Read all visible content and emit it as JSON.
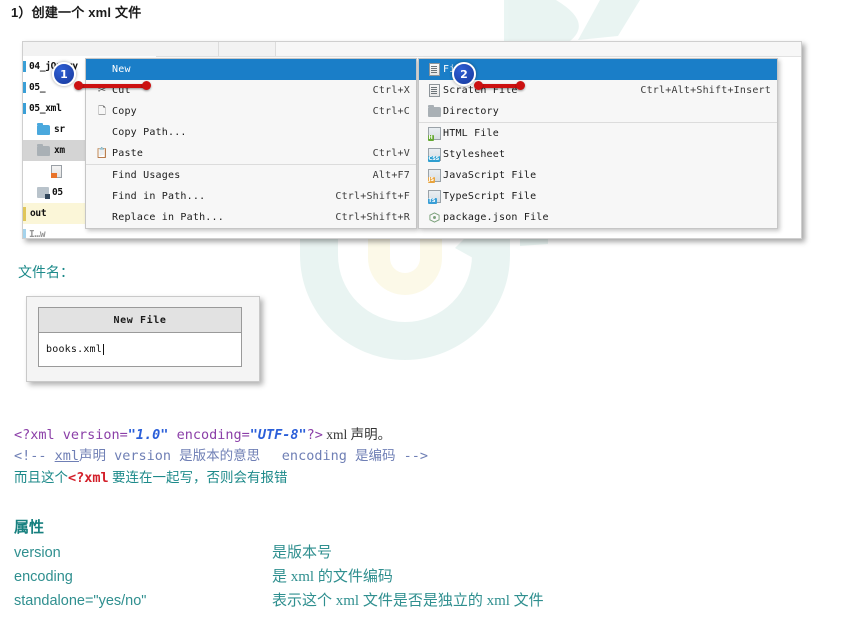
{
  "heading": "1）创建一个 xml 文件",
  "ide": {
    "tabs": [
      "",
      ""
    ],
    "tree": [
      {
        "label": "04_jQuery",
        "icon": "module-bar-icon",
        "selected": false
      },
      {
        "label": "05_",
        "icon": "module-bar-icon",
        "selected": false
      },
      {
        "label": "05_xml",
        "icon": "module-bar-icon",
        "selected": false
      },
      {
        "label": "sr",
        "icon": "folder-blue-icon",
        "selected": false
      },
      {
        "label": "xm",
        "icon": "folder-grey-icon",
        "selected": true
      },
      {
        "label": "",
        "icon": "xml-file-icon",
        "selected": false
      },
      {
        "label": "05",
        "icon": "module-icon",
        "selected": false
      },
      {
        "label": "out",
        "icon": "output-folder-icon",
        "selected": false
      }
    ],
    "context_menu": [
      {
        "label": "New",
        "accel": "",
        "icon": "",
        "highlight": true,
        "separator": false,
        "mnemonic": "N"
      },
      {
        "label": "Cut",
        "accel": "Ctrl+X",
        "icon": "scissors-icon",
        "highlight": false,
        "separator": false,
        "mnemonic": "t"
      },
      {
        "label": "Copy",
        "accel": "Ctrl+C",
        "icon": "copy-icon",
        "highlight": false,
        "separator": false,
        "mnemonic": "C"
      },
      {
        "label": "Copy Path...",
        "accel": "",
        "icon": "",
        "highlight": false,
        "separator": false,
        "mnemonic": ""
      },
      {
        "label": "Paste",
        "accel": "Ctrl+V",
        "icon": "paste-icon",
        "highlight": false,
        "separator": false,
        "mnemonic": "P"
      },
      {
        "label": "Find Usages",
        "accel": "Alt+F7",
        "icon": "",
        "highlight": false,
        "separator": true,
        "mnemonic": "U"
      },
      {
        "label": "Find in Path...",
        "accel": "Ctrl+Shift+F",
        "icon": "",
        "highlight": false,
        "separator": false,
        "mnemonic": "P"
      },
      {
        "label": "Replace in Path...",
        "accel": "Ctrl+Shift+R",
        "icon": "",
        "highlight": false,
        "separator": false,
        "mnemonic": ""
      }
    ],
    "submenu": [
      {
        "label": "File",
        "accel": "",
        "icon": "file-icon",
        "highlight": true,
        "separator": false
      },
      {
        "label": "Scratch File",
        "accel": "Ctrl+Alt+Shift+Insert",
        "icon": "scratch-file-icon",
        "highlight": false,
        "separator": false
      },
      {
        "label": "Directory",
        "accel": "",
        "icon": "directory-icon",
        "highlight": false,
        "separator": false
      },
      {
        "label": "HTML File",
        "accel": "",
        "icon": "html-file-icon",
        "highlight": false,
        "separator": true
      },
      {
        "label": "Stylesheet",
        "accel": "",
        "icon": "css-file-icon",
        "highlight": false,
        "separator": false
      },
      {
        "label": "JavaScript File",
        "accel": "",
        "icon": "js-file-icon",
        "highlight": false,
        "separator": false
      },
      {
        "label": "TypeScript File",
        "accel": "",
        "icon": "ts-file-icon",
        "highlight": false,
        "separator": false
      },
      {
        "label": "package.json File",
        "accel": "",
        "icon": "package-json-icon",
        "highlight": false,
        "separator": false
      }
    ],
    "callouts": [
      {
        "number": "1"
      },
      {
        "number": "2"
      }
    ]
  },
  "filename_caption": "文件名：",
  "newfile_dialog": {
    "title": "New File",
    "value": "books.xml"
  },
  "code": {
    "line1": {
      "p1": "<?xml version=",
      "p2": "\"1.0\"",
      "p3": " encoding=",
      "p4": "\"UTF-8\"",
      "p5": "?>",
      "p6": " xml 声明。"
    },
    "line2": {
      "p1": "<!-- ",
      "p2": "xml",
      "p3": "声明 version 是版本的意思　 encoding 是编码  -->"
    },
    "line3": {
      "p1": "而且这个",
      "p2": "<?xml",
      "p3": " 要连在一起写，否则会有报错"
    }
  },
  "attributes": {
    "title": "属性",
    "rows": [
      {
        "key": "version",
        "value": "是版本号"
      },
      {
        "key": "encoding",
        "value": "是 xml 的文件编码"
      },
      {
        "key": "standalone=\"yes/no\"",
        "value": "表示这个 xml 文件是否是独立的 xml 文件"
      }
    ]
  },
  "colors": {
    "menu_highlight": "#1a7ec8",
    "callout_bubble": "#17389c",
    "callout_bar": "#cc1111",
    "teal_text": "#2f8f8f",
    "code_purple": "#8b3fa8",
    "code_red": "#d31f2a"
  }
}
